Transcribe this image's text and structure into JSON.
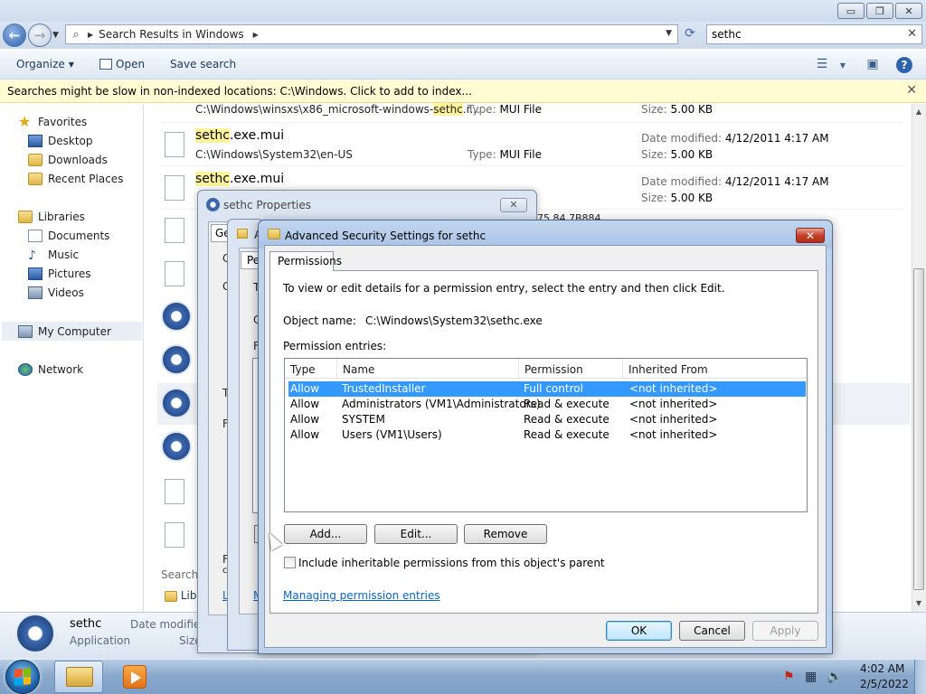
{
  "explorer": {
    "window_buttons": {
      "minimize": "▭",
      "maximize": "❐",
      "close": "✕"
    },
    "address": {
      "text": "Search Results in Windows"
    },
    "search": {
      "value": "sethc"
    },
    "commands": {
      "organize": "Organize",
      "open": "Open",
      "save_search": "Save search"
    },
    "info_bar": "Searches might be slow in non-indexed locations: C:\\Windows. Click to add to index...",
    "nav": {
      "favorites": "Favorites",
      "desktop": "Desktop",
      "downloads": "Downloads",
      "recent_places": "Recent Places",
      "libraries": "Libraries",
      "documents": "Documents",
      "music": "Music",
      "pictures": "Pictures",
      "videos": "Videos",
      "my_computer": "My Computer",
      "network": "Network"
    },
    "files": [
      {
        "path_prefix": "C:\\Windows\\winsxs\\x86_microsoft-windows-",
        "path_hl": "sethc",
        "path_suffix": ".r...",
        "type_label": "Type:",
        "type": "MUI File",
        "size_label": "Size:",
        "size": "5.00 KB"
      },
      {
        "name_hl": "sethc",
        "name_rest": ".exe.mui",
        "path": "C:\\Windows\\System32\\en-US",
        "type_label": "Type:",
        "type": "MUI File",
        "date_label": "Date modified:",
        "date": "4/12/2011 4:17 AM",
        "size_label": "Size:",
        "size": "5.00 KB"
      },
      {
        "name_hl": "sethc",
        "name_rest": ".exe.mui",
        "date_label": "Date modified:",
        "date": "4/12/2011 4:17 AM",
        "size_label": "Size:",
        "size": "5.00 KB"
      }
    ],
    "search_again": "Search",
    "lib_fragment": "Libr",
    "details": {
      "name": "sethc",
      "kind": "Application",
      "date_fragment": "Date modified",
      "size_fragment": "Size"
    }
  },
  "props_dialog": {
    "title": "sethc Properties",
    "tab_fragment": "Ge",
    "fragments": {
      "a": "A",
      "pe": "Pe",
      "c1": "C",
      "g": "G",
      "t1": "T",
      "c2": "C",
      "f1": "F",
      "t2": "T",
      "f2": "F",
      "l": "L",
      "m": "M",
      "f3": "F",
      "c3": "c"
    },
    "title_fragment": "75 84 7B884"
  },
  "adv_dialog": {
    "title": "Advanced Security Settings for sethc",
    "tab": "Permissions",
    "intro": "To view or edit details for a permission entry, select the entry and then click Edit.",
    "object_label": "Object name:",
    "object_value": "C:\\Windows\\System32\\sethc.exe",
    "entries_label": "Permission entries:",
    "columns": [
      "Type",
      "Name",
      "Permission",
      "Inherited From"
    ],
    "entries": [
      {
        "type": "Allow",
        "name": "TrustedInstaller",
        "permission": "Full control",
        "inherited": "<not inherited>"
      },
      {
        "type": "Allow",
        "name": "Administrators (VM1\\Administrators)",
        "permission": "Read & execute",
        "inherited": "<not inherited>"
      },
      {
        "type": "Allow",
        "name": "SYSTEM",
        "permission": "Read & execute",
        "inherited": "<not inherited>"
      },
      {
        "type": "Allow",
        "name": "Users (VM1\\Users)",
        "permission": "Read & execute",
        "inherited": "<not inherited>"
      }
    ],
    "buttons": {
      "add": "Add...",
      "edit": "Edit...",
      "remove": "Remove",
      "ok": "OK",
      "cancel": "Cancel",
      "apply": "Apply"
    },
    "inherit_label": "Include inheritable permissions from this object's parent",
    "manage_link": "Managing permission entries"
  },
  "taskbar": {
    "time": "4:02 AM",
    "date": "2/5/2022"
  },
  "colors": {
    "selection": "#3399ff",
    "highlight": "#fff39b",
    "info_bar": "#fffbd2"
  }
}
